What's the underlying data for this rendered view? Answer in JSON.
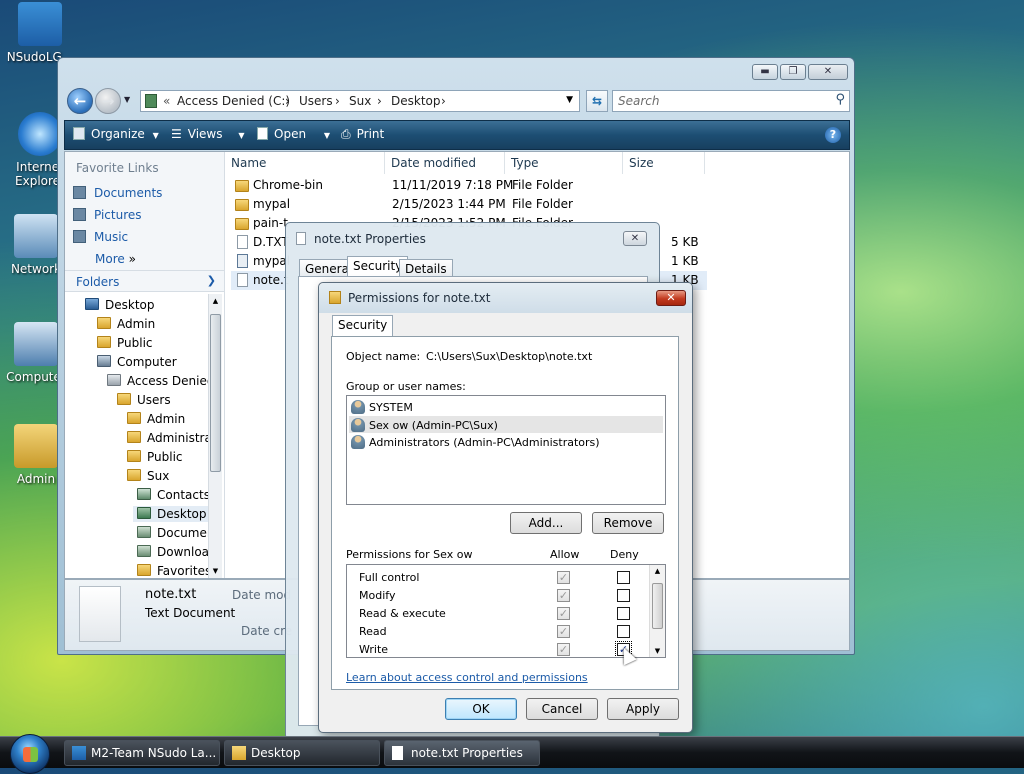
{
  "desktop": {
    "icons": [
      {
        "label": "NSudoLG..."
      },
      {
        "label": "Internet Explorer"
      },
      {
        "label": "Network"
      },
      {
        "label": "Computer"
      },
      {
        "label": "Admin"
      }
    ]
  },
  "explorer": {
    "breadcrumb": [
      "Access Denied (C:)",
      "Users",
      "Sux",
      "Desktop"
    ],
    "search_placeholder": "Search",
    "toolbar": {
      "organize": "Organize",
      "views": "Views",
      "open": "Open",
      "print": "Print"
    },
    "favorite_links_title": "Favorite Links",
    "favorite_links": [
      "Documents",
      "Pictures",
      "Music"
    ],
    "more": "More",
    "folders_title": "Folders",
    "tree": [
      "Desktop",
      "Admin",
      "Public",
      "Computer",
      "Access Denied",
      "Users",
      "Admin",
      "Administra",
      "Public",
      "Sux",
      "Contacts",
      "Desktop",
      "Documen",
      "Downloa",
      "Favorites"
    ],
    "columns": [
      "Name",
      "Date modified",
      "Type",
      "Size"
    ],
    "files": [
      {
        "name": "Chrome-bin",
        "date": "11/11/2019 7:18 PM",
        "type": "File Folder",
        "size": ""
      },
      {
        "name": "mypal",
        "date": "2/15/2023 1:44 PM",
        "type": "File Folder",
        "size": ""
      },
      {
        "name": "pain-t",
        "date": "2/15/2023 1:52 PM",
        "type": "File Folder",
        "size": ""
      },
      {
        "name": "D.TXT",
        "date": "",
        "type": "",
        "size": "5 KB"
      },
      {
        "name": "mypal",
        "date": "",
        "type": "",
        "size": "1 KB"
      },
      {
        "name": "note.t",
        "date": "",
        "type": "",
        "size": "1 KB"
      }
    ],
    "details": {
      "name": "note.txt",
      "type": "Text Document",
      "date_modified_label": "Date mod",
      "date_created_label": "Date cre"
    }
  },
  "properties": {
    "title": "note.txt Properties",
    "tabs": [
      "General",
      "Security",
      "Details"
    ]
  },
  "permissions": {
    "title": "Permissions for note.txt",
    "tab": "Security",
    "object_name_label": "Object name:",
    "object_name_value": "C:\\Users\\Sux\\Desktop\\note.txt",
    "group_label": "Group or user names:",
    "users": [
      "SYSTEM",
      "Sex ow (Admin-PC\\Sux)",
      "Administrators (Admin-PC\\Administrators)"
    ],
    "add_button": "Add...",
    "remove_button": "Remove",
    "perm_label": "Permissions for Sex ow",
    "allow_label": "Allow",
    "deny_label": "Deny",
    "perms": [
      {
        "name": "Full control",
        "allow": true,
        "deny": false
      },
      {
        "name": "Modify",
        "allow": true,
        "deny": false
      },
      {
        "name": "Read & execute",
        "allow": true,
        "deny": false
      },
      {
        "name": "Read",
        "allow": true,
        "deny": false
      },
      {
        "name": "Write",
        "allow": true,
        "deny": true
      }
    ],
    "learn_link": "Learn about access control and permissions",
    "ok": "OK",
    "cancel": "Cancel",
    "apply": "Apply"
  },
  "taskbar": {
    "items": [
      "M2-Team NSudo La...",
      "Desktop",
      "note.txt Properties"
    ]
  }
}
